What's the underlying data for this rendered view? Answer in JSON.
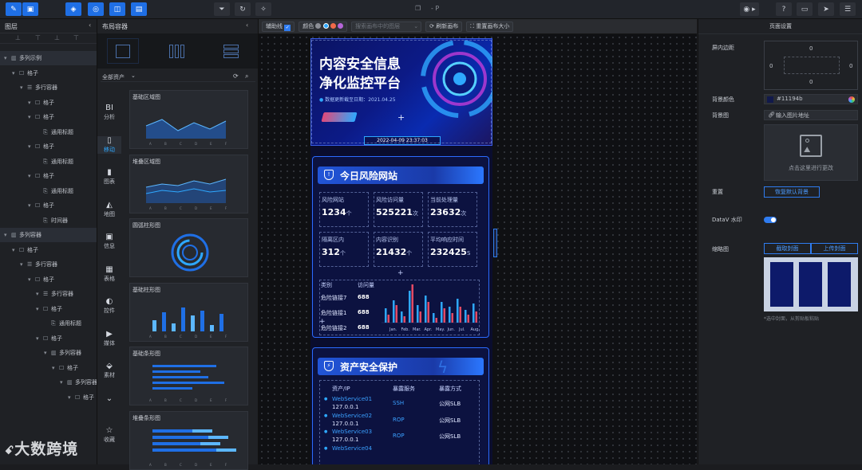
{
  "topbar": {
    "title": "- P",
    "center_icon": "window-icon"
  },
  "toolbar": {
    "guides": "辅助线",
    "color": "颜色",
    "search_placeholder": "搜索画布中的图层",
    "refresh": "刷新画布",
    "reset_size": "重置画布大小"
  },
  "layers": {
    "title": "图层",
    "tree": [
      {
        "label": "多列示例",
        "indent": 0,
        "type": "columns"
      },
      {
        "label": "格子",
        "indent": 1,
        "type": "cell"
      },
      {
        "label": "多行容器",
        "indent": 2,
        "type": "rows"
      },
      {
        "label": "格子",
        "indent": 3,
        "type": "cell"
      },
      {
        "label": "格子",
        "indent": 3,
        "type": "cell"
      },
      {
        "label": "通用标题",
        "indent": 4,
        "type": "widget"
      },
      {
        "label": "格子",
        "indent": 3,
        "type": "cell"
      },
      {
        "label": "通用标题",
        "indent": 4,
        "type": "widget"
      },
      {
        "label": "格子",
        "indent": 3,
        "type": "cell"
      },
      {
        "label": "通用标题",
        "indent": 4,
        "type": "widget"
      },
      {
        "label": "格子",
        "indent": 3,
        "type": "cell"
      },
      {
        "label": "时间器",
        "indent": 4,
        "type": "widget"
      },
      {
        "label": "多列容器",
        "indent": 0,
        "type": "columns"
      },
      {
        "label": "格子",
        "indent": 1,
        "type": "cell"
      },
      {
        "label": "多行容器",
        "indent": 2,
        "type": "rows"
      },
      {
        "label": "格子",
        "indent": 3,
        "type": "cell"
      },
      {
        "label": "多行容器",
        "indent": 4,
        "type": "rows"
      },
      {
        "label": "格子",
        "indent": 4,
        "type": "cell"
      },
      {
        "label": "通用标题",
        "indent": 5,
        "type": "widget"
      },
      {
        "label": "格子",
        "indent": 4,
        "type": "cell"
      },
      {
        "label": "多列容器",
        "indent": 5,
        "type": "columns"
      },
      {
        "label": "格子",
        "indent": 6,
        "type": "cell"
      },
      {
        "label": "多列容器",
        "indent": 7,
        "type": "columns"
      },
      {
        "label": "格子",
        "indent": 8,
        "type": "cell"
      }
    ]
  },
  "components": {
    "title": "布局容器",
    "category_select": "全部资产",
    "categories": [
      {
        "label": "BI\n分析",
        "icon": "bi-icon"
      },
      {
        "label": "移动",
        "icon": "mobile-icon"
      },
      {
        "label": "图表",
        "icon": "chart-icon"
      },
      {
        "label": "地图",
        "icon": "map-icon"
      },
      {
        "label": "信息",
        "icon": "info-icon"
      },
      {
        "label": "表格",
        "icon": "table-icon"
      },
      {
        "label": "控件",
        "icon": "control-icon"
      },
      {
        "label": "媒体",
        "icon": "media-icon"
      },
      {
        "label": "素材",
        "icon": "material-icon"
      },
      {
        "label": "",
        "icon": "chevron-down-icon"
      },
      {
        "label": "收藏",
        "icon": "star-icon"
      }
    ],
    "cards": [
      "基础区域图",
      "堆叠区域图",
      "圆弧柱形图",
      "基础柱形图",
      "基础条形图",
      "堆叠条形图"
    ],
    "axis_letters": [
      "A",
      "B",
      "C",
      "D",
      "E",
      "F"
    ]
  },
  "screen": {
    "title_line1": "内容安全信息",
    "title_line2": "净化监控平台",
    "update_label": "数据更新截至日期：",
    "update_date": "2021.04.25",
    "clock": "2022-04-09 23:37:03",
    "risk": {
      "title": "今日风险网站",
      "stats": [
        {
          "label": "风险网站",
          "value": "1234",
          "unit": "个"
        },
        {
          "label": "风险访问量",
          "value": "525221",
          "unit": "次"
        },
        {
          "label": "当前处理量",
          "value": "23632",
          "unit": "次"
        },
        {
          "label": "隔离区内",
          "value": "312",
          "unit": "个"
        },
        {
          "label": "内容识别",
          "value": "21432",
          "unit": "个"
        },
        {
          "label": "平均响应时间",
          "value": "232425",
          "unit": "S"
        }
      ],
      "table_headers": [
        "类别",
        "访问量"
      ],
      "rows": [
        {
          "name": "危险链接7",
          "value": "688"
        },
        {
          "name": "危险链接1",
          "value": "688"
        },
        {
          "name": "危险链接2",
          "value": "688"
        }
      ],
      "months": [
        "Jan.",
        "Feb.",
        "Mar.",
        "Apr.",
        "May.",
        "Jun.",
        "Jul.",
        "Aug."
      ]
    },
    "asset": {
      "title": "资产安全保护",
      "headers": [
        "资产/IP",
        "暴露服务",
        "暴露方式"
      ],
      "rows": [
        {
          "name": "WebService01",
          "ip": "127.0.0.1",
          "service": "SSH",
          "method": "公网SLB"
        },
        {
          "name": "WebService02",
          "ip": "127.0.0.1",
          "service": "ROP",
          "method": "公网SLB"
        },
        {
          "name": "WebService03",
          "ip": "127.0.0.1",
          "service": "ROP",
          "method": "公网SLB"
        },
        {
          "name": "WebService04",
          "ip": "",
          "service": "",
          "method": ""
        }
      ]
    }
  },
  "settings": {
    "title": "页面设置",
    "padding_label": "屏内边距",
    "padding": [
      "0",
      "0",
      "0",
      "0"
    ],
    "bg_color_label": "背景颜色",
    "bg_color": "#11194b",
    "bg_image_label": "背景图",
    "bg_image_input": "输入图片地址",
    "upload_hint": "点击这里进行更改",
    "reset_label": "重置",
    "reset_button": "恢复默认背景",
    "watermark_label": "DataV 水印",
    "thumb_label": "缩略图",
    "capture_button": "截取封面",
    "upload_button": "上传封面",
    "thumb_hint": "*选中封面，从剪贴板粘贴"
  },
  "watermark": {
    "logo": "大数跨境"
  },
  "colors": {
    "accent": "#1f6fe5",
    "screen_bg": "#0a0d2e",
    "cyan": "#2ea8ff",
    "red": "#e24a64"
  }
}
